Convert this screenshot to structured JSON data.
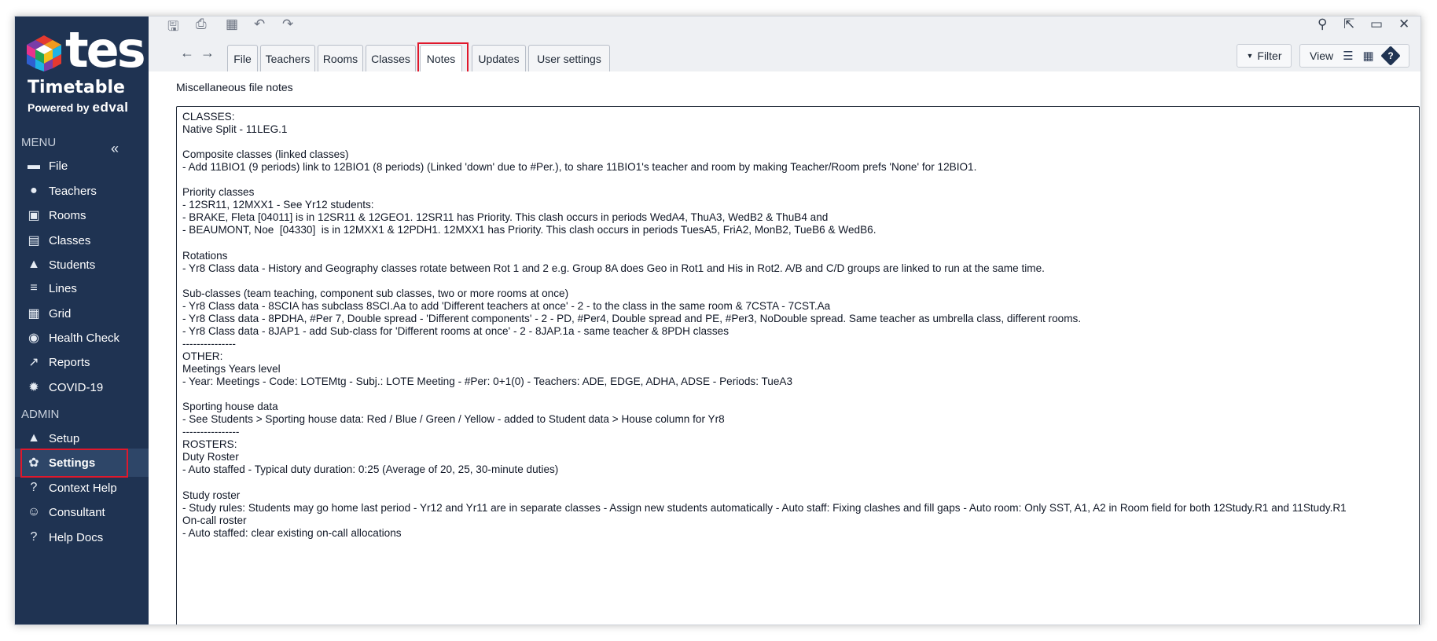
{
  "brand": {
    "logo_text": "tes",
    "product": "Timetable",
    "powered_by": "Powered by",
    "powered_by_brand": "edval"
  },
  "sidebar": {
    "menu_label": "MENU",
    "collapse_icon": "«",
    "admin_label": "ADMIN",
    "menu_items": [
      {
        "label": "File",
        "icon": "folder-icon",
        "glyph": "▬"
      },
      {
        "label": "Teachers",
        "icon": "person-icon",
        "glyph": "●"
      },
      {
        "label": "Rooms",
        "icon": "chair-icon",
        "glyph": "▣"
      },
      {
        "label": "Classes",
        "icon": "book-icon",
        "glyph": "▤"
      },
      {
        "label": "Students",
        "icon": "graduation-cap-icon",
        "glyph": "▲"
      },
      {
        "label": "Lines",
        "icon": "lines-icon",
        "glyph": "≡"
      },
      {
        "label": "Grid",
        "icon": "grid-icon",
        "glyph": "▦"
      },
      {
        "label": "Health Check",
        "icon": "stopwatch-icon",
        "glyph": "◉"
      },
      {
        "label": "Reports",
        "icon": "trending-up-icon",
        "glyph": "↗"
      },
      {
        "label": "COVID-19",
        "icon": "virus-icon",
        "glyph": "✹"
      }
    ],
    "admin_items": [
      {
        "label": "Setup",
        "icon": "lock-icon",
        "glyph": "▲"
      },
      {
        "label": "Settings",
        "icon": "gear-icon",
        "glyph": "✿"
      },
      {
        "label": "Context Help",
        "icon": "help-bubble-icon",
        "glyph": "?"
      },
      {
        "label": "Consultant",
        "icon": "consultant-icon",
        "glyph": "☺"
      },
      {
        "label": "Help Docs",
        "icon": "help-docs-icon",
        "glyph": "?"
      }
    ],
    "active_item": "Settings"
  },
  "toolbar": {
    "icons": [
      {
        "name": "save-icon",
        "glyph": "🖫"
      },
      {
        "name": "print-icon",
        "glyph": "⎙"
      },
      {
        "name": "export-icon",
        "glyph": "▦"
      },
      {
        "name": "undo-icon",
        "glyph": "↶"
      },
      {
        "name": "redo-icon",
        "glyph": "↷"
      }
    ],
    "window_icons": [
      {
        "name": "search-icon",
        "glyph": "⚲"
      },
      {
        "name": "popout-icon",
        "glyph": "⇱"
      },
      {
        "name": "maximize-icon",
        "glyph": "▭"
      },
      {
        "name": "close-icon",
        "glyph": "✕"
      }
    ],
    "back_glyph": "←",
    "forward_glyph": "→",
    "tabs": [
      "File",
      "Teachers",
      "Rooms",
      "Classes",
      "Notes",
      "Updates",
      "User settings"
    ],
    "active_tab": "Notes",
    "filter_label": "Filter",
    "filter_glyph": "▼",
    "view_label": "View",
    "view_list_glyph": "☰",
    "view_table_glyph": "▦",
    "help_glyph": "?"
  },
  "content": {
    "title": "Miscellaneous file notes",
    "notes_lines": [
      "CLASSES:",
      "Native Split - 11LEG.1",
      "",
      "Composite classes (linked classes)",
      "- Add 11BIO1 (9 periods) link to 12BIO1 (8 periods) (Linked 'down' due to #Per.), to share 11BIO1's teacher and room by making Teacher/Room prefs 'None' for 12BIO1.",
      "",
      "Priority classes",
      "- 12SR11, 12MXX1 - See Yr12 students:",
      "- BRAKE, Fleta [04011] is in 12SR11 & 12GEO1. 12SR11 has Priority. This clash occurs in periods WedA4, ThuA3, WedB2 & ThuB4 and",
      "- BEAUMONT, Noe  [04330]  is in 12MXX1 & 12PDH1. 12MXX1 has Priority. This clash occurs in periods TuesA5, FriA2, MonB2, TueB6 & WedB6.",
      "",
      "Rotations",
      "- Yr8 Class data - History and Geography classes rotate between Rot 1 and 2 e.g. Group 8A does Geo in Rot1 and His in Rot2. A/B and C/D groups are linked to run at the same time.",
      "",
      "Sub-classes (team teaching, component sub classes, two or more rooms at once)",
      "- Yr8 Class data - 8SCIA has subclass 8SCI.Aa to add 'Different teachers at once' - 2 - to the class in the same room & 7CSTA - 7CST.Aa",
      "- Yr8 Class data - 8PDHA, #Per 7, Double spread - 'Different components' - 2 - PD, #Per4, Double spread and PE, #Per3, NoDouble spread. Same teacher as umbrella class, different rooms.",
      "- Yr8 Class data - 8JAP1 - add Sub-class for 'Different rooms at once' - 2 - 8JAP.1a - same teacher & 8PDH classes",
      "---------------",
      "OTHER:",
      "Meetings Years level",
      "- Year: Meetings - Code: LOTEMtg - Subj.: LOTE Meeting - #Per: 0+1(0) - Teachers: ADE, EDGE, ADHA, ADSE - Periods: TueA3",
      "",
      "Sporting house data",
      "- See Students > Sporting house data: Red / Blue / Green / Yellow - added to Student data > House column for Yr8",
      "----------------",
      "ROSTERS:",
      "Duty Roster",
      "- Auto staffed - Typical duty duration: 0:25 (Average of 20, 25, 30-minute duties)",
      "",
      "Study roster",
      "- Study rules: Students may go home last period - Yr12 and Yr11 are in separate classes - Assign new students automatically - Auto staff: Fixing clashes and fill gaps - Auto room: Only SST, A1, A2 in Room field for both 12Study.R1 and 11Study.R1",
      "On-call roster",
      "- Auto staffed: clear existing on-call allocations"
    ]
  },
  "colors": {
    "sidebar_bg": "#1f3352",
    "highlight": "#e0182c"
  }
}
